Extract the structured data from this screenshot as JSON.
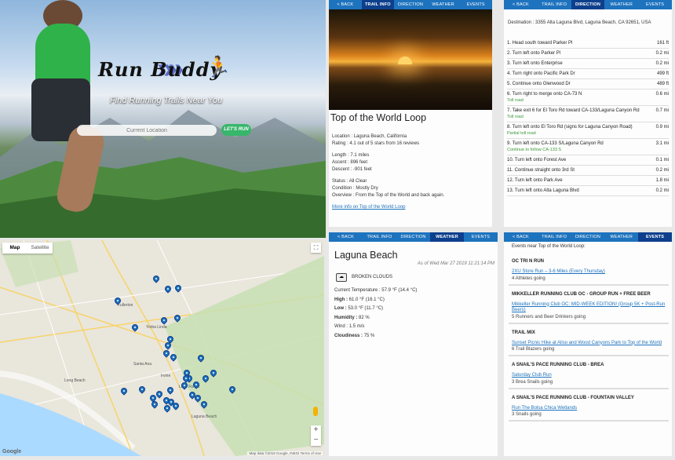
{
  "hero": {
    "logo": "Run Buddy",
    "tagline": "Find Running Trails Near You",
    "search_placeholder": "Current Location",
    "cta_label": "LET'S RUN"
  },
  "tabs": [
    "< BACK",
    "TRAIL INFO",
    "DIRECTION",
    "WEATHER",
    "EVENTS"
  ],
  "trail": {
    "title": "Top of the World Loop",
    "location_label": "Location :",
    "location": "Laguna Beach, California",
    "rating_label": "Rating :",
    "rating": "4.1 out of 5 stars from 16 reviews",
    "length_label": "Length :",
    "length": "7.1 miles",
    "ascent_label": "Ascent :",
    "ascent": "896 feet",
    "descent_label": "Descent :",
    "descent": "-901 feet",
    "status_label": "Status :",
    "status": "All Clear",
    "condition_label": "Condition :",
    "condition": "Mostly Dry",
    "overview_label": "Overview :",
    "overview": "From the Top of the World and back again.",
    "more_link": "More info on Top of the World Loop"
  },
  "direction": {
    "destination_label": "Destination :",
    "destination": "3355 Alta Laguna Blvd, Laguna Beach, CA 92651, USA",
    "steps": [
      {
        "text": "1. Head south toward Parker Pl",
        "dist": "161 ft",
        "note": ""
      },
      {
        "text": "2. Turn left onto Parker Pl",
        "dist": "0.2 mi",
        "note": ""
      },
      {
        "text": "3. Turn left onto Enterprise",
        "dist": "0.2 mi",
        "note": ""
      },
      {
        "text": "4. Turn right onto Pacific Park Dr",
        "dist": "499 ft",
        "note": ""
      },
      {
        "text": "5. Continue onto Glenwood Dr",
        "dist": "489 ft",
        "note": ""
      },
      {
        "text": "6. Turn right to merge onto CA-73 N",
        "dist": "0.6 mi",
        "note": "Toll road"
      },
      {
        "text": "7. Take exit 6 for El Toro Rd toward CA-133/Laguna Canyon Rd",
        "dist": "0.7 mi",
        "note": "Toll road"
      },
      {
        "text": "8. Turn left onto El Toro Rd (signs for Laguna Canyon Road)",
        "dist": "0.9 mi",
        "note": "Partial toll road"
      },
      {
        "text": "9. Turn left onto CA-133 S/Laguna Canyon Rd",
        "dist": "3.1 mi",
        "note": "Continue to follow CA-133 S"
      },
      {
        "text": "10. Turn left onto Forest Ave",
        "dist": "0.1 mi",
        "note": ""
      },
      {
        "text": "11. Continue straight onto 3rd St",
        "dist": "0.2 mi",
        "note": ""
      },
      {
        "text": "12. Turn left onto Park Ave",
        "dist": "1.8 mi",
        "note": ""
      },
      {
        "text": "13. Turn left onto Alta Laguna Blvd",
        "dist": "0.2 mi",
        "note": ""
      }
    ]
  },
  "map": {
    "map_label": "Map",
    "satellite_label": "Satellite",
    "google": "Google",
    "attribution": "Map data ©2019 Google, INEGI   Terms of Use",
    "cities": [
      "Fullerton",
      "Yorba Linda",
      "Santa Ana",
      "Irvine",
      "Lake Forest",
      "Laguna Beach",
      "Long Beach"
    ]
  },
  "weather": {
    "city": "Laguna Beach",
    "as_of": "As of Wed Mar 27 2019 11:21:14 PM",
    "condition": "BROKEN CLOUDS",
    "temp_label": "Current Temperature :",
    "temp": "57.9 °F (14.4 °C)",
    "high_label": "High :",
    "high": "61.0 °F (16.1 °C)",
    "low_label": "Low :",
    "low": "53.0 °F (11.7 °C)",
    "humidity_label": "Humidity :",
    "humidity": "82 %",
    "wind_label": "Wind :",
    "wind": "1.5 m/s",
    "cloudiness_label": "Cloudiness :",
    "cloudiness": "75 %"
  },
  "events": {
    "heading": "Events near Top of the World Loop:",
    "items": [
      {
        "group": "OC TRI N RUN",
        "link": "2XU Store Run – 3-6 Miles (Every Thursday)",
        "going": "4 Athletes going"
      },
      {
        "group": "MIKKELLER RUNNING CLUB OC - GROUP RUN + FREE BEER",
        "link": "Mikkeller Running Club OC: MID-WEEK EDITION! (Group 5K + Post-Run Beers)",
        "going": "5 Runners and Beer Drinkers going"
      },
      {
        "group": "TRAIL MIX",
        "link": "Sunset Picnic Hike at Aliso and Wood Canyons Park to Top of the World",
        "going": "6 Trail Blazers going"
      },
      {
        "group": "A SNAIL'S PACE RUNNING CLUB - BREA",
        "link": "Saturday Club Run",
        "going": "3 Brea Snails going"
      },
      {
        "group": "A SNAIL'S PACE RUNNING CLUB - FOUNTAIN VALLEY",
        "link": "Run The Bolsa Chica Wetlands",
        "going": "3 Snails going"
      }
    ]
  },
  "colors": {
    "tab_bar": "#1e73be",
    "tab_active": "#0d3f8c",
    "link": "#1e73be",
    "cta": "#38b66b"
  }
}
